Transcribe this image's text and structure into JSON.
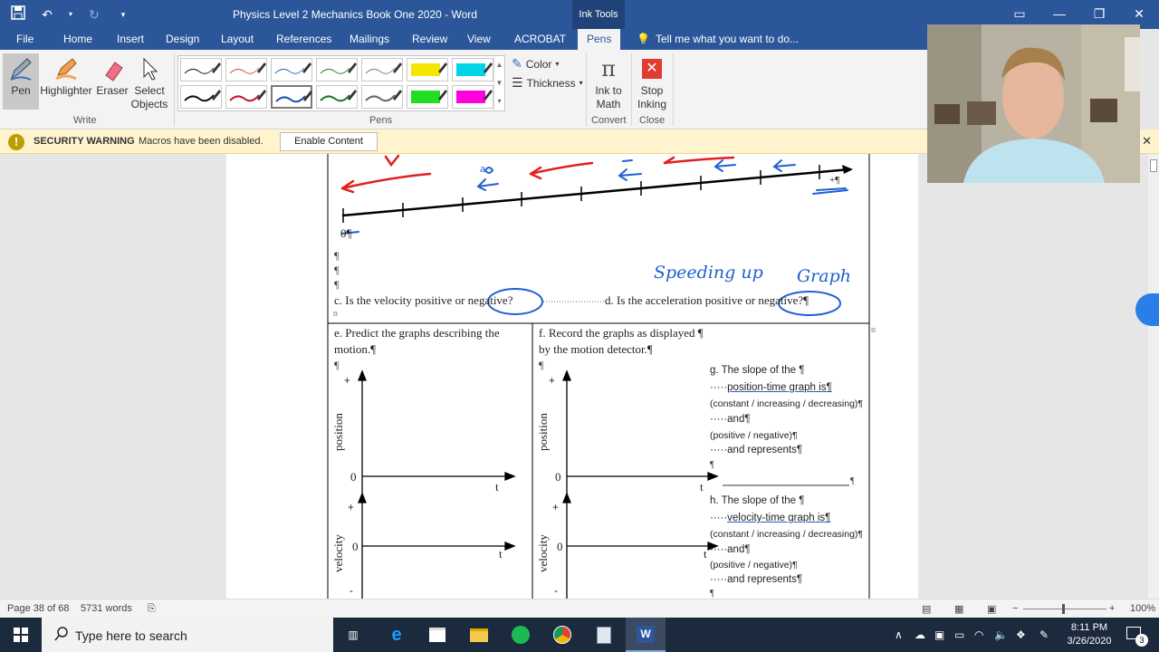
{
  "window": {
    "title": "Physics Level 2 Mechanics Book One 2020 - Word",
    "context_tab": "Ink Tools"
  },
  "tabs": [
    "File",
    "Home",
    "Insert",
    "Design",
    "Layout",
    "References",
    "Mailings",
    "Review",
    "View",
    "ACROBAT",
    "Pens"
  ],
  "active_tab": "Pens",
  "tell_me": "Tell me what you want to do...",
  "ribbon": {
    "write": {
      "label": "Write",
      "pen": "Pen",
      "highlighter": "Highlighter",
      "eraser": "Eraser",
      "select_line1": "Select",
      "select_line2": "Objects"
    },
    "pens": {
      "label": "Pens",
      "row1": [
        "#222222",
        "#d9534f",
        "#3a6fc4",
        "#2e8b3e",
        "#888888",
        "#f5e600",
        "#00d5e8"
      ],
      "row2": [
        "#111111",
        "#c8102e",
        "#1f4fa8",
        "#1a7a2a",
        "#666666",
        "#22dd22",
        "#ff00dd"
      ],
      "selected_index": 9
    },
    "color": "Color",
    "thickness": "Thickness",
    "convert": {
      "label": "Convert",
      "ink_to_math_line1": "Ink to",
      "ink_to_math_line2": "Math"
    },
    "close": {
      "label": "Close",
      "stop_line1": "Stop",
      "stop_line2": "Inking"
    }
  },
  "security": {
    "title": "SECURITY WARNING",
    "message": "Macros have been disabled.",
    "button": "Enable Content"
  },
  "document": {
    "zero_label": "0¶",
    "plus_label": "+¶",
    "q_c_text": "c. Is the velocity positive or ",
    "q_c_answer": "negative?",
    "q_d_text": "d. Is the acceleration positive or ",
    "q_d_answer": "negative?¶",
    "ink_speeding": "Speeding up",
    "ink_graph": "Graph",
    "ink_v": "v",
    "ink_a": "a",
    "q_e_line1": "e. Predict the graphs describing the",
    "q_e_line2": "motion.¶",
    "q_f_line1": "f. Record the graphs as displayed ¶",
    "q_f_line2": "by the motion detector.¶",
    "axis_position": "position",
    "axis_velocity": "velocity",
    "axis_t": "t",
    "axis_zero": "0",
    "axis_plus": "+",
    "axis_minus": "-",
    "g_title": "g. The slope of the ¶",
    "g_l1": "position-time graph is¶",
    "g_l2": "(constant / increasing / decreasing)¶",
    "g_l3": "and¶",
    "g_l4": "(positive / negative)¶",
    "g_l5": "and represents¶",
    "h_title": "h. The slope of the ¶",
    "h_l1": "velocity-time graph is¶",
    "h_l2": "(constant / increasing / decreasing)¶",
    "h_l3": "and¶",
    "h_l4": "(positive / negative)¶",
    "h_l5": "and represents¶",
    "pilcrow": "¶",
    "cell_mark": "¤"
  },
  "status": {
    "page": "Page 38 of 68",
    "words": "5731 words",
    "zoom": "100%"
  },
  "taskbar": {
    "search": "Type here to search",
    "time": "8:11 PM",
    "date": "3/26/2020",
    "notif_count": "3"
  }
}
